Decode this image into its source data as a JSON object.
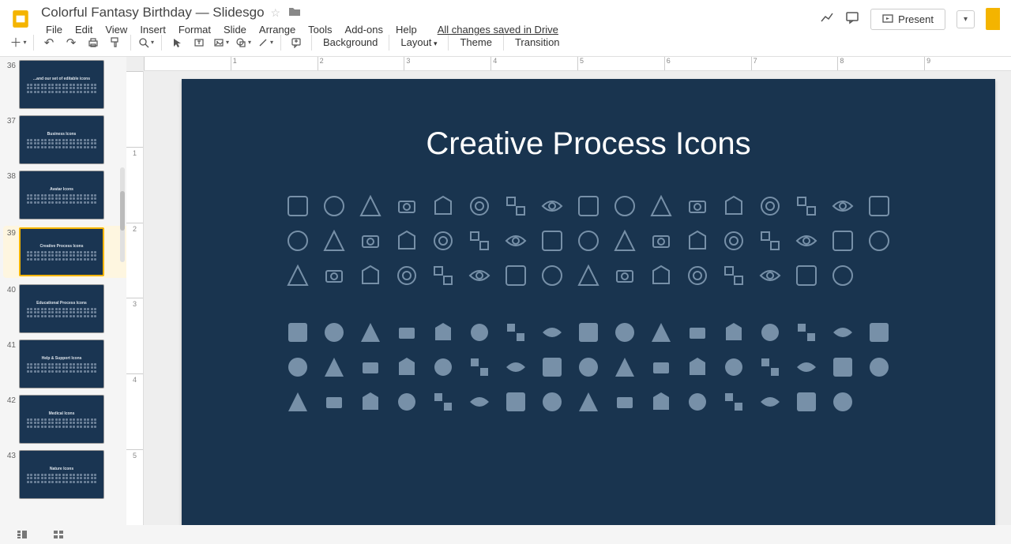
{
  "app": {
    "title": "Colorful Fantasy Birthday — Slidesgo",
    "save_status": "All changes saved in Drive"
  },
  "menu": {
    "file": "File",
    "edit": "Edit",
    "view": "View",
    "insert": "Insert",
    "format": "Format",
    "slide": "Slide",
    "arrange": "Arrange",
    "tools": "Tools",
    "addons": "Add-ons",
    "help": "Help"
  },
  "toolbar": {
    "background": "Background",
    "layout": "Layout",
    "theme": "Theme",
    "transition": "Transition"
  },
  "controls": {
    "present": "Present"
  },
  "filmstrip": {
    "slides": [
      {
        "num": "36",
        "title": "...and our set of editable icons"
      },
      {
        "num": "37",
        "title": "Business Icons"
      },
      {
        "num": "38",
        "title": "Avatar Icons"
      },
      {
        "num": "39",
        "title": "Creative Process Icons",
        "selected": true
      },
      {
        "num": "40",
        "title": "Educational Process Icons"
      },
      {
        "num": "41",
        "title": "Help & Support Icons"
      },
      {
        "num": "42",
        "title": "Medical Icons"
      },
      {
        "num": "43",
        "title": "Nature Icons"
      }
    ]
  },
  "ruler": {
    "h": [
      "",
      "1",
      "2",
      "3",
      "4",
      "5",
      "6",
      "7",
      "8",
      "9"
    ],
    "v": [
      "",
      "1",
      "2",
      "3",
      "4",
      "5"
    ]
  },
  "slide": {
    "title": "Creative Process Icons",
    "outline_rows": 3,
    "filled_rows": 3,
    "cols_full": 17,
    "cols_short": 16
  }
}
